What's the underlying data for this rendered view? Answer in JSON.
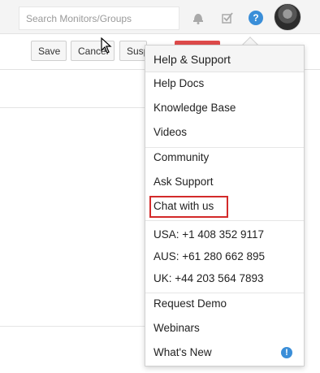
{
  "header": {
    "search_placeholder": "Search Monitors/Groups",
    "help_glyph": "?",
    "icons": [
      "bell-icon",
      "checkbox-icon",
      "help-icon",
      "user-avatar"
    ]
  },
  "toolbar": {
    "save_label": "Save",
    "cancel_label": "Cancel",
    "suspend_label": "Suspend"
  },
  "menu": {
    "title": "Help & Support",
    "items": [
      {
        "label": "Help Docs"
      },
      {
        "label": "Knowledge Base"
      },
      {
        "label": "Videos"
      },
      {
        "label": "Community"
      },
      {
        "label": "Ask Support"
      },
      {
        "label": "Chat with us"
      },
      {
        "label": "USA:  +1 408 352 9117"
      },
      {
        "label": "AUS:  +61 280 662 895"
      },
      {
        "label": "UK:  +44 203 564 7893"
      },
      {
        "label": "Request Demo"
      },
      {
        "label": "Webinars"
      },
      {
        "label": "What's New"
      }
    ],
    "new_badge_glyph": "!"
  },
  "colors": {
    "accent_blue": "#3a8ed8",
    "highlight_red": "#d32a2a",
    "danger_button": "#e04b4b"
  }
}
